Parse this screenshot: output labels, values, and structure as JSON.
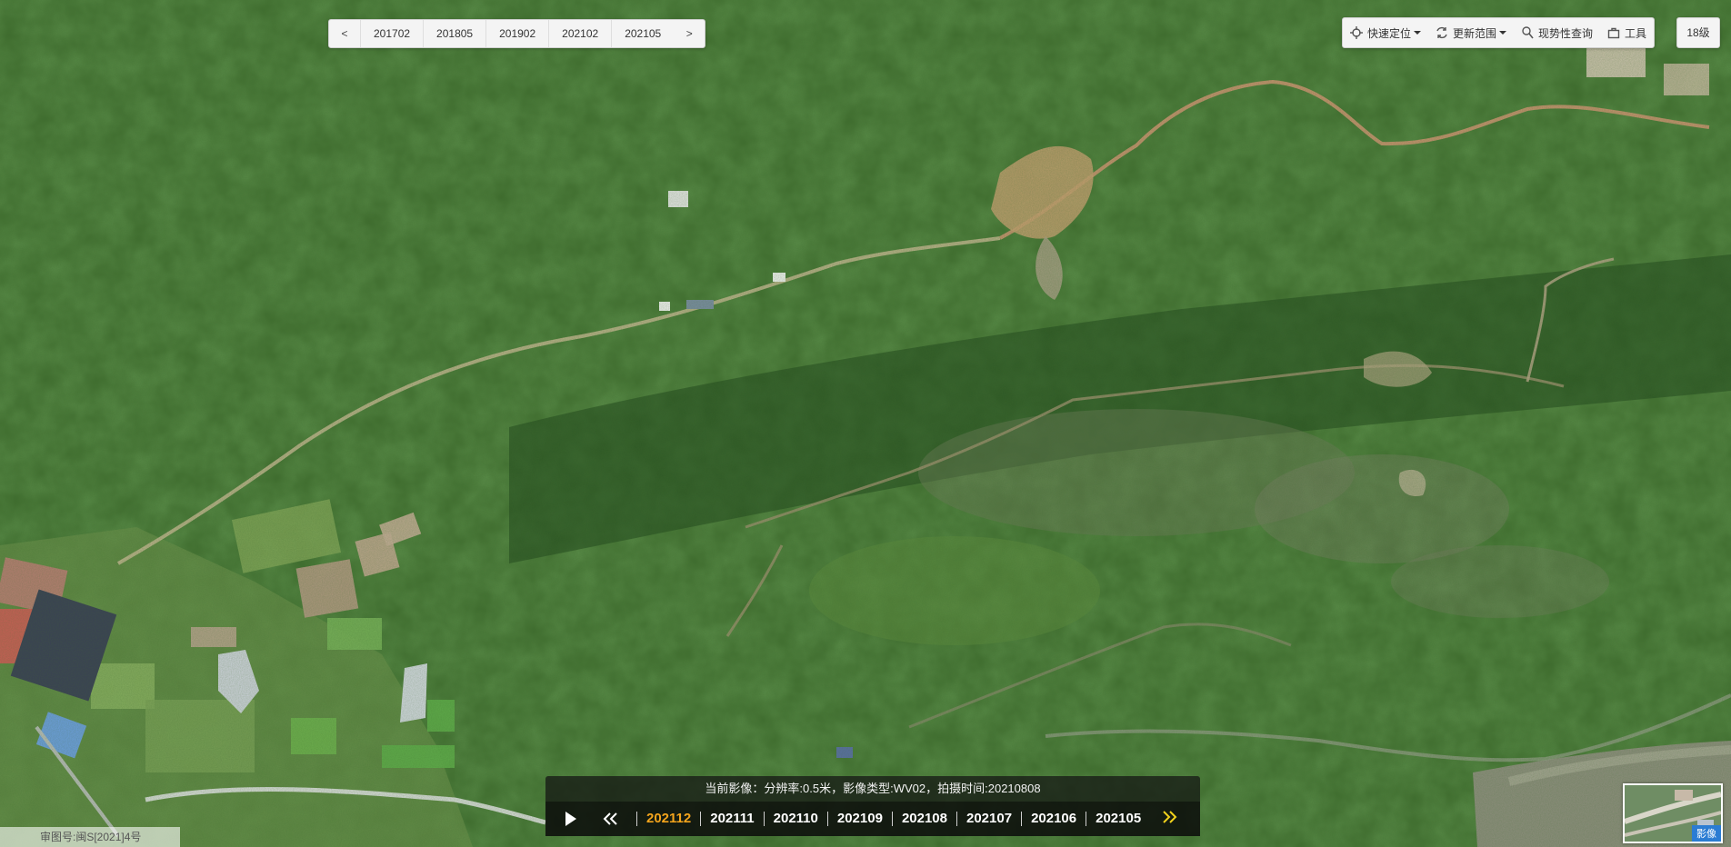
{
  "date_bar": {
    "prev_label": "<",
    "next_label": ">",
    "dates": [
      "201702",
      "201805",
      "201902",
      "202102",
      "202105"
    ]
  },
  "toolbar": {
    "quick_locate": "快速定位",
    "update_range": "更新范围",
    "current_query": "现势性查询",
    "tools": "工具"
  },
  "zoom_level": "18级",
  "info": {
    "current_image": "当前影像：分辨率:0.5米，影像类型:WV02，拍摄时间:20210808"
  },
  "timeline": {
    "active": "202112",
    "items": [
      "202112",
      "202111",
      "202110",
      "202109",
      "202108",
      "202107",
      "202106",
      "202105"
    ]
  },
  "minimap": {
    "label": "影像"
  },
  "approval": "审图号:闽S[2021]4号",
  "colors": {
    "active_timeline": "#f4a41c",
    "minimap_badge": "#2b7cd3"
  }
}
